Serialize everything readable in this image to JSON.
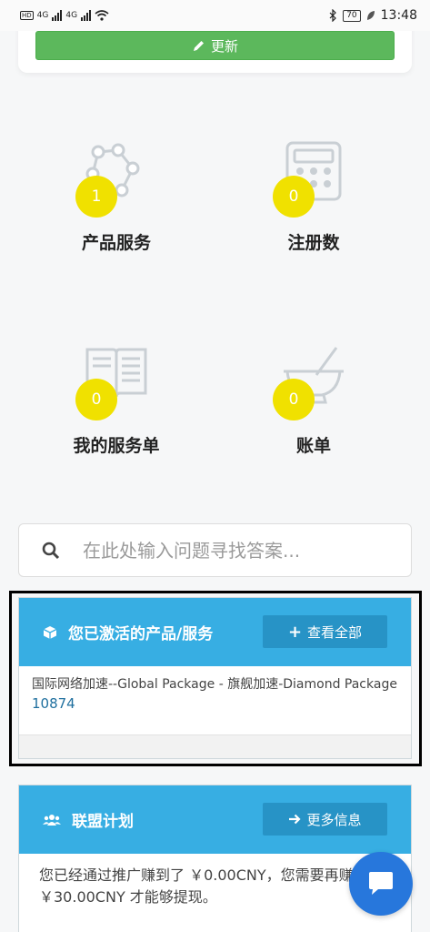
{
  "status_bar": {
    "net1": "4G",
    "net2": "4G",
    "battery": "70",
    "time": "13:48"
  },
  "top": {
    "update_label": "更新"
  },
  "tiles": [
    {
      "icon": "molecule-icon",
      "count": "1",
      "label": "产品服务"
    },
    {
      "icon": "calculator-icon",
      "count": "0",
      "label": "注册数"
    },
    {
      "icon": "book-icon",
      "count": "0",
      "label": "我的服务单"
    },
    {
      "icon": "mortar-pestle-icon",
      "count": "0",
      "label": "账单"
    }
  ],
  "search": {
    "placeholder": "在此处输入问题寻找答案..."
  },
  "active_products": {
    "title": "您已激活的产品/服务",
    "button": "查看全部",
    "item_text": "国际网络加速--Global Package - 旗舰加速-Diamond Package",
    "item_id": "10874"
  },
  "affiliate": {
    "title": "联盟计划",
    "button": "更多信息",
    "text": "您已经通过推广赚到了 ￥0.00CNY，您需要再赚 ￥30.00CNY 才能够提现。"
  },
  "colors": {
    "green": "#5cb85c",
    "panel_blue": "#37aee3",
    "badge_yellow": "#f0e100",
    "chat_blue": "#2777dc"
  }
}
